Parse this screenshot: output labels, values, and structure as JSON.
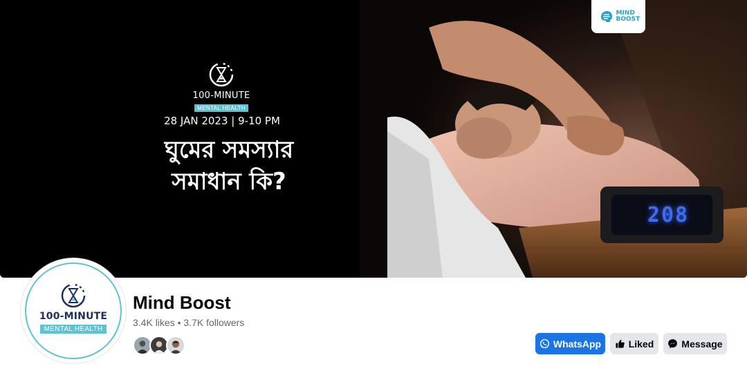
{
  "cover": {
    "logo_minute": "100-MINUTE",
    "logo_mental": "MENTAL HEALTH",
    "event_date": "28 JAN 2023 | 9-10 PM",
    "title_line1": "ঘুমের সমস্যার",
    "title_line2": "সমাধান কি?",
    "clock_digits": "208",
    "brand_badge_text": "MIND BOOST"
  },
  "profile": {
    "name": "Mind Boost",
    "stats": "3.4K likes • 3.7K followers",
    "avatar_minute": "100-MINUTE",
    "avatar_mental": "MENTAL HEALTH",
    "liker_faces_count": 3
  },
  "actions": {
    "whatsapp_label": "WhatsApp",
    "liked_label": "Liked",
    "message_label": "Message"
  },
  "colors": {
    "facebook_blue": "#1b74e4",
    "secondary_button": "#e4e6eb",
    "brand_teal": "#5cc2d4",
    "clock_blue": "#3d6cf0"
  },
  "icons": {
    "whatsapp": "whatsapp-icon",
    "liked": "thumbs-up-icon",
    "message": "messenger-icon"
  }
}
